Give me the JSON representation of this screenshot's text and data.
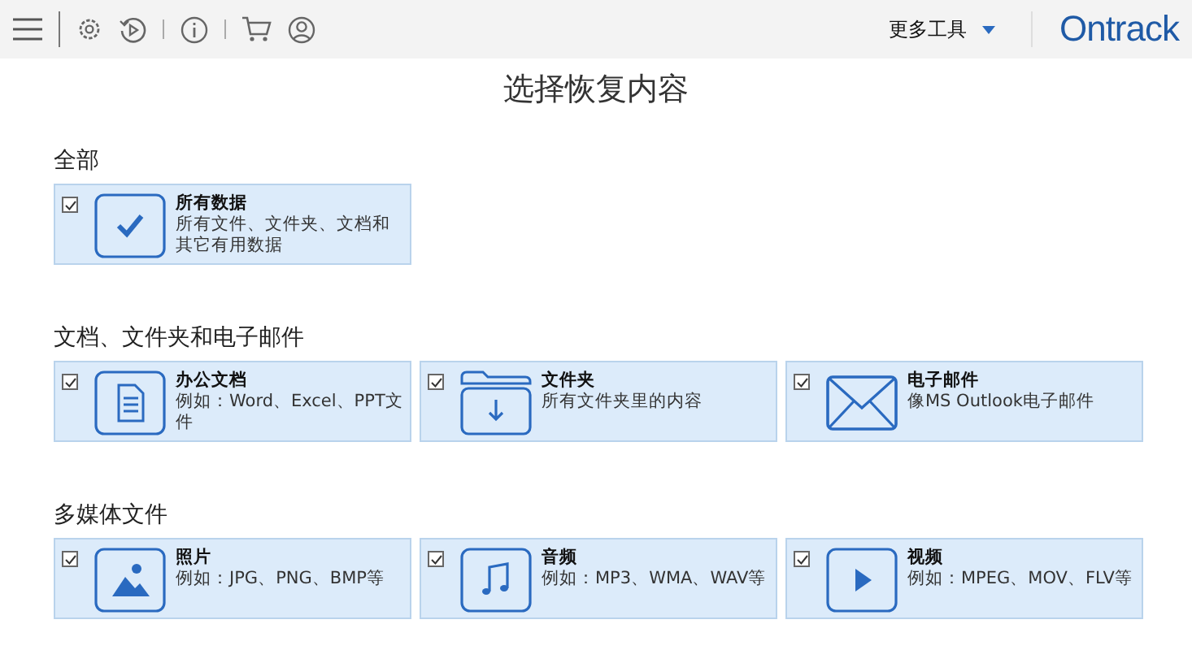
{
  "toolbar": {
    "more_tools": "更多工具",
    "logo": "Ontrack"
  },
  "title": "选择恢复内容",
  "sections": [
    {
      "heading": "全部",
      "cards": [
        {
          "kind": "all",
          "title": "所有数据",
          "desc": "所有文件、文件夹、文档和其它有用数据",
          "checked": true
        }
      ]
    },
    {
      "heading": "文档、文件夹和电子邮件",
      "cards": [
        {
          "kind": "document",
          "title": "办公文档",
          "desc": "例如：Word、Excel、PPT文件",
          "checked": true
        },
        {
          "kind": "folder",
          "title": "文件夹",
          "desc": "所有文件夹里的内容",
          "checked": true
        },
        {
          "kind": "email",
          "title": "电子邮件",
          "desc": "像MS Outlook电子邮件",
          "checked": true
        }
      ]
    },
    {
      "heading": "多媒体文件",
      "cards": [
        {
          "kind": "photo",
          "title": "照片",
          "desc": "例如：JPG、PNG、BMP等",
          "checked": true
        },
        {
          "kind": "audio",
          "title": "音频",
          "desc": "例如：MP3、WMA、WAV等",
          "checked": true
        },
        {
          "kind": "video",
          "title": "视频",
          "desc": "例如：MPEG、MOV、FLV等",
          "checked": true
        }
      ]
    }
  ]
}
